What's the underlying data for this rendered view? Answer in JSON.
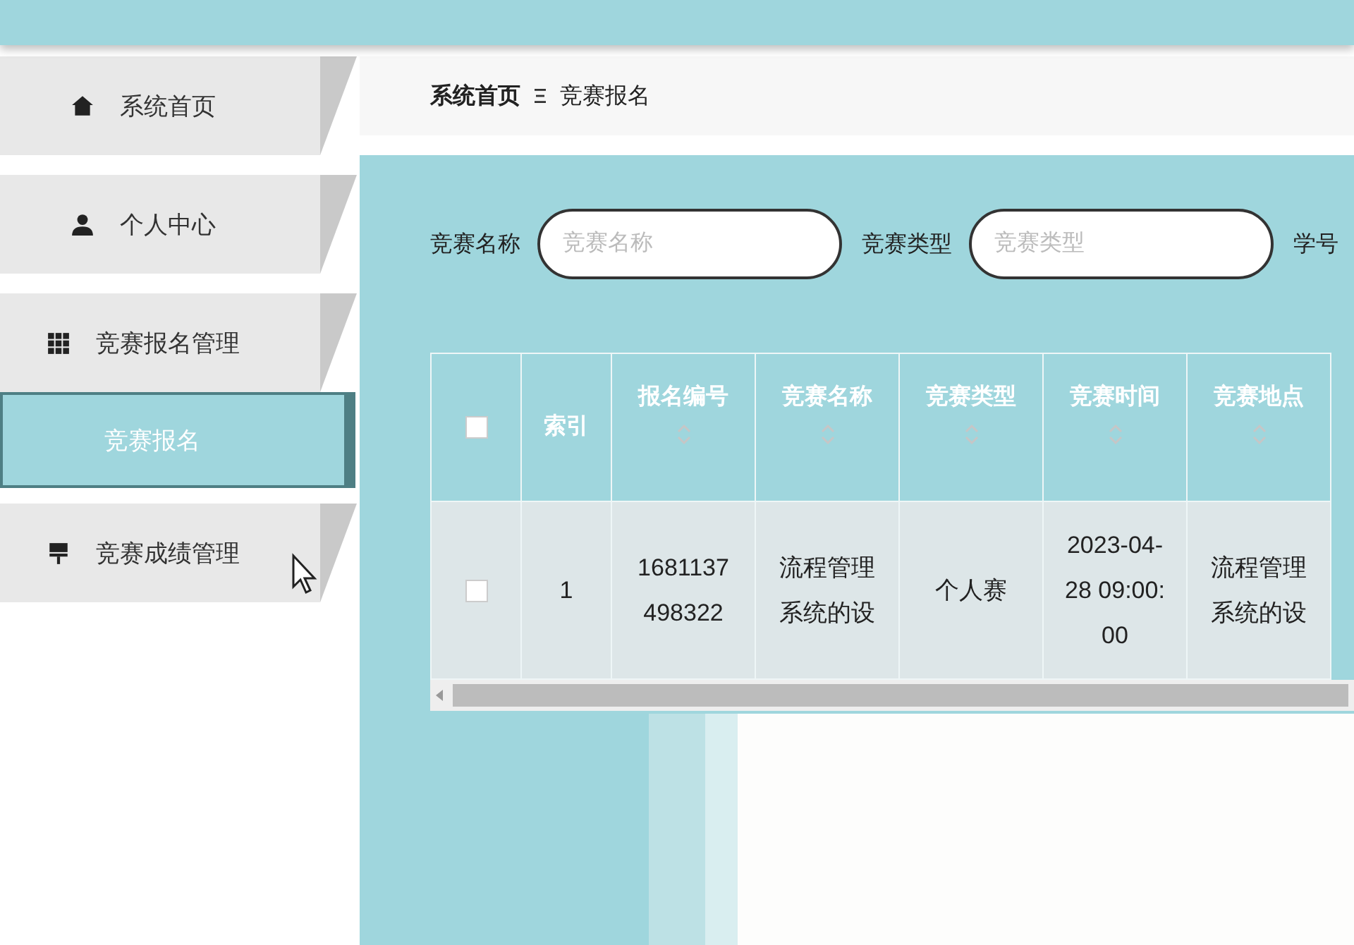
{
  "sidebar": {
    "items": [
      {
        "label": "系统首页",
        "kind": "home",
        "selected": false
      },
      {
        "label": "个人中心",
        "kind": "person",
        "selected": false
      },
      {
        "label": "竞赛报名管理",
        "kind": "grid",
        "selected": false
      },
      {
        "label": "竞赛报名",
        "kind": "subitem",
        "selected": true
      },
      {
        "label": "竞赛成绩管理",
        "kind": "flag",
        "selected": false
      }
    ]
  },
  "breadcrumb": [
    "系统首页",
    "竞赛报名"
  ],
  "search": {
    "fields": [
      {
        "label": "竞赛名称",
        "placeholder": "竞赛名称"
      },
      {
        "label": "竞赛类型",
        "placeholder": "竞赛类型"
      },
      {
        "label": "学号"
      }
    ]
  },
  "table": {
    "select_all": false,
    "columns": [
      {
        "label": "索引",
        "sortable": false
      },
      {
        "label": "报名编号",
        "sortable": true
      },
      {
        "label": "竞赛名称",
        "sortable": true
      },
      {
        "label": "竞赛类型",
        "sortable": true
      },
      {
        "label": "竞赛时间",
        "sortable": true
      },
      {
        "label": "竞赛地点",
        "sortable": true
      }
    ],
    "rows": [
      {
        "checked": false,
        "cells": [
          "1",
          "1681137498322",
          "流程管理系统的设",
          "个人赛",
          "2023-04-28 09:00:00",
          "流程管理系统的设"
        ]
      }
    ]
  }
}
